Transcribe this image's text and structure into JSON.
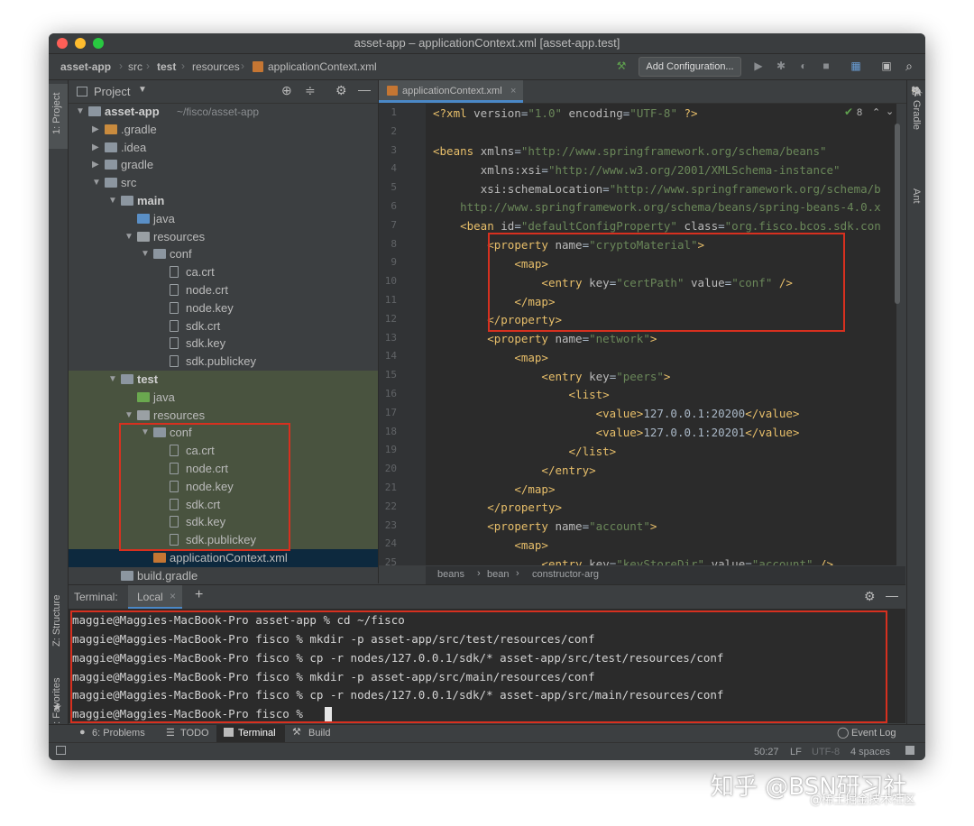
{
  "window": {
    "title": "asset-app – applicationContext.xml [asset-app.test]"
  },
  "navbar": {
    "crumbs": [
      "asset-app",
      "src",
      "test",
      "resources",
      "applicationContext.xml"
    ],
    "add_configuration": "Add Configuration..."
  },
  "left_strip": {
    "project": "1: Project",
    "structure": "Z: Structure",
    "favorites": "2: Favorites"
  },
  "right_strip": {
    "gradle": "Gradle",
    "ant": "Ant"
  },
  "project_panel": {
    "title": "Project",
    "tree": [
      {
        "label": "asset-app",
        "suffix": "~/fisco/asset-app",
        "bold": true
      },
      {
        "label": ".gradle"
      },
      {
        "label": ".idea"
      },
      {
        "label": "gradle"
      },
      {
        "label": "src"
      },
      {
        "label": "main",
        "bold": true
      },
      {
        "label": "java"
      },
      {
        "label": "resources"
      },
      {
        "label": "conf"
      },
      {
        "label": "ca.crt"
      },
      {
        "label": "node.crt"
      },
      {
        "label": "node.key"
      },
      {
        "label": "sdk.crt"
      },
      {
        "label": "sdk.key"
      },
      {
        "label": "sdk.publickey"
      },
      {
        "label": "test",
        "bold": true
      },
      {
        "label": "java"
      },
      {
        "label": "resources"
      },
      {
        "label": "conf"
      },
      {
        "label": "ca.crt"
      },
      {
        "label": "node.crt"
      },
      {
        "label": "node.key"
      },
      {
        "label": "sdk.crt"
      },
      {
        "label": "sdk.key"
      },
      {
        "label": "sdk.publickey"
      },
      {
        "label": "applicationContext.xml"
      },
      {
        "label": "build.gradle"
      }
    ]
  },
  "editor": {
    "tab": "applicationContext.xml",
    "inspection_count": "8",
    "line_numbers": [
      "1",
      "2",
      "3",
      "4",
      "5",
      "6",
      "7",
      "8",
      "9",
      "10",
      "11",
      "12",
      "13",
      "14",
      "15",
      "16",
      "17",
      "18",
      "19",
      "20",
      "21",
      "22",
      "23",
      "24",
      "25"
    ],
    "breadcrumb": [
      "beans",
      "bean",
      "constructor-arg"
    ]
  },
  "terminal": {
    "label": "Terminal:",
    "tab": "Local",
    "lines": [
      "maggie@Maggies-MacBook-Pro asset-app % cd ~/fisco",
      "maggie@Maggies-MacBook-Pro fisco % mkdir -p asset-app/src/test/resources/conf",
      "maggie@Maggies-MacBook-Pro fisco % cp -r nodes/127.0.0.1/sdk/* asset-app/src/test/resources/conf",
      "maggie@Maggies-MacBook-Pro fisco % mkdir -p asset-app/src/main/resources/conf",
      "maggie@Maggies-MacBook-Pro fisco % cp -r nodes/127.0.0.1/sdk/* asset-app/src/main/resources/conf",
      "maggie@Maggies-MacBook-Pro fisco % "
    ]
  },
  "bottom_tools": {
    "problems": "6: Problems",
    "todo": "TODO",
    "terminal": "Terminal",
    "build": "Build",
    "event_log": "Event Log"
  },
  "status": {
    "position": "50:27",
    "line_sep": "LF",
    "encoding": "UTF-8",
    "indent": "4 spaces"
  },
  "watermark": "知乎 @BSN研习社",
  "watermark_sub": "@稀土掘金技术社区",
  "colors": {
    "highlight_red": "#d7301f",
    "xml_tag": "#e8bf6a",
    "xml_value": "#6a8759",
    "selection": "#0d293e"
  }
}
